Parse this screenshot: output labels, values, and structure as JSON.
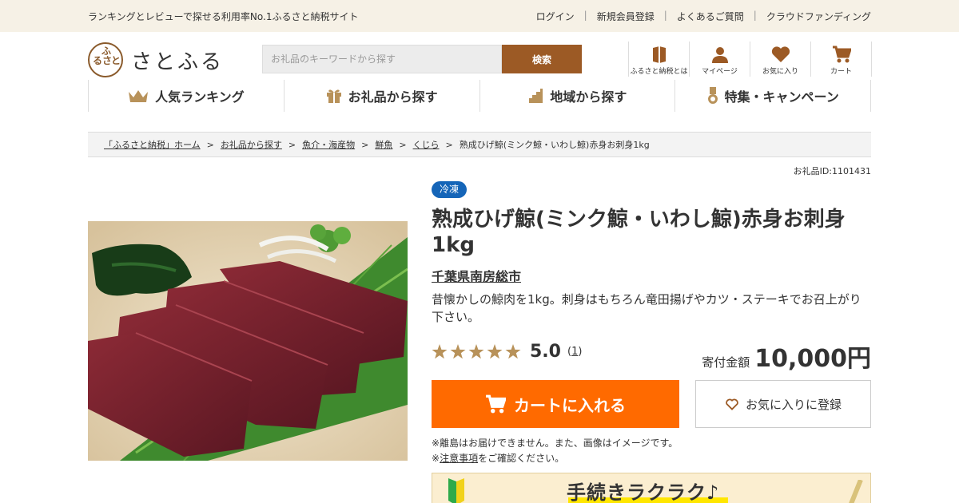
{
  "topbar": {
    "tagline": "ランキングとレビューで探せる利用率No.1ふるさと納税サイト",
    "links": [
      "ログイン",
      "新規会員登録",
      "よくあるご質問",
      "クラウドファンディング"
    ]
  },
  "logo": {
    "mark_chars": [
      "ふ",
      "る",
      "さ",
      "と"
    ],
    "text": "さとふる"
  },
  "search": {
    "placeholder": "お礼品のキーワードから探す",
    "button": "検索"
  },
  "iconnav": [
    {
      "label": "ふるさと納税とは",
      "icon": "book-icon"
    },
    {
      "label": "マイページ",
      "icon": "user-icon"
    },
    {
      "label": "お気に入り",
      "icon": "heart-icon"
    },
    {
      "label": "カート",
      "icon": "cart-icon"
    }
  ],
  "mainnav": [
    {
      "label": "人気ランキング",
      "icon": "crown-icon"
    },
    {
      "label": "お礼品から探す",
      "icon": "gift-icon"
    },
    {
      "label": "地域から探す",
      "icon": "region-icon"
    },
    {
      "label": "特集・キャンペーン",
      "icon": "medal-icon"
    }
  ],
  "breadcrumb": [
    "「ふるさと納税」ホーム",
    "お礼品から探す",
    "魚介・海産物",
    "鮮魚",
    "くじら",
    "熟成ひげ鯨(ミンク鯨・いわし鯨)赤身お刺身1kg"
  ],
  "product": {
    "gift_id": "お礼品ID:1101431",
    "badge": "冷凍",
    "title": "熟成ひげ鯨(ミンク鯨・いわし鯨)赤身お刺身1kg",
    "area": "千葉県南房総市",
    "description": "昔懐かしの鯨肉を1kg。刺身はもちろん竜田揚げやカツ・ステーキでお召上がり下さい。",
    "rating": 5.0,
    "rating_text": "5.0",
    "review_count_open": "(",
    "review_count": "1",
    "review_count_close": ")",
    "price_label": "寄付金額",
    "price": "10,000円"
  },
  "actions": {
    "cart": "カートに入れる",
    "favorite": "お気に入りに登録"
  },
  "notes": {
    "line1": "※離島はお届けできません。また、画像はイメージです。",
    "line2_prefix": "※",
    "line2_link": "注意事項",
    "line2_suffix": "をご確認ください。"
  },
  "banner": {
    "text": "手続きラクラク♪"
  },
  "colors": {
    "accent": "#ff6a00",
    "brand": "#9c5a25",
    "badge": "#1565b8",
    "star": "#b8925a",
    "topbar": "#f6f1e6"
  }
}
